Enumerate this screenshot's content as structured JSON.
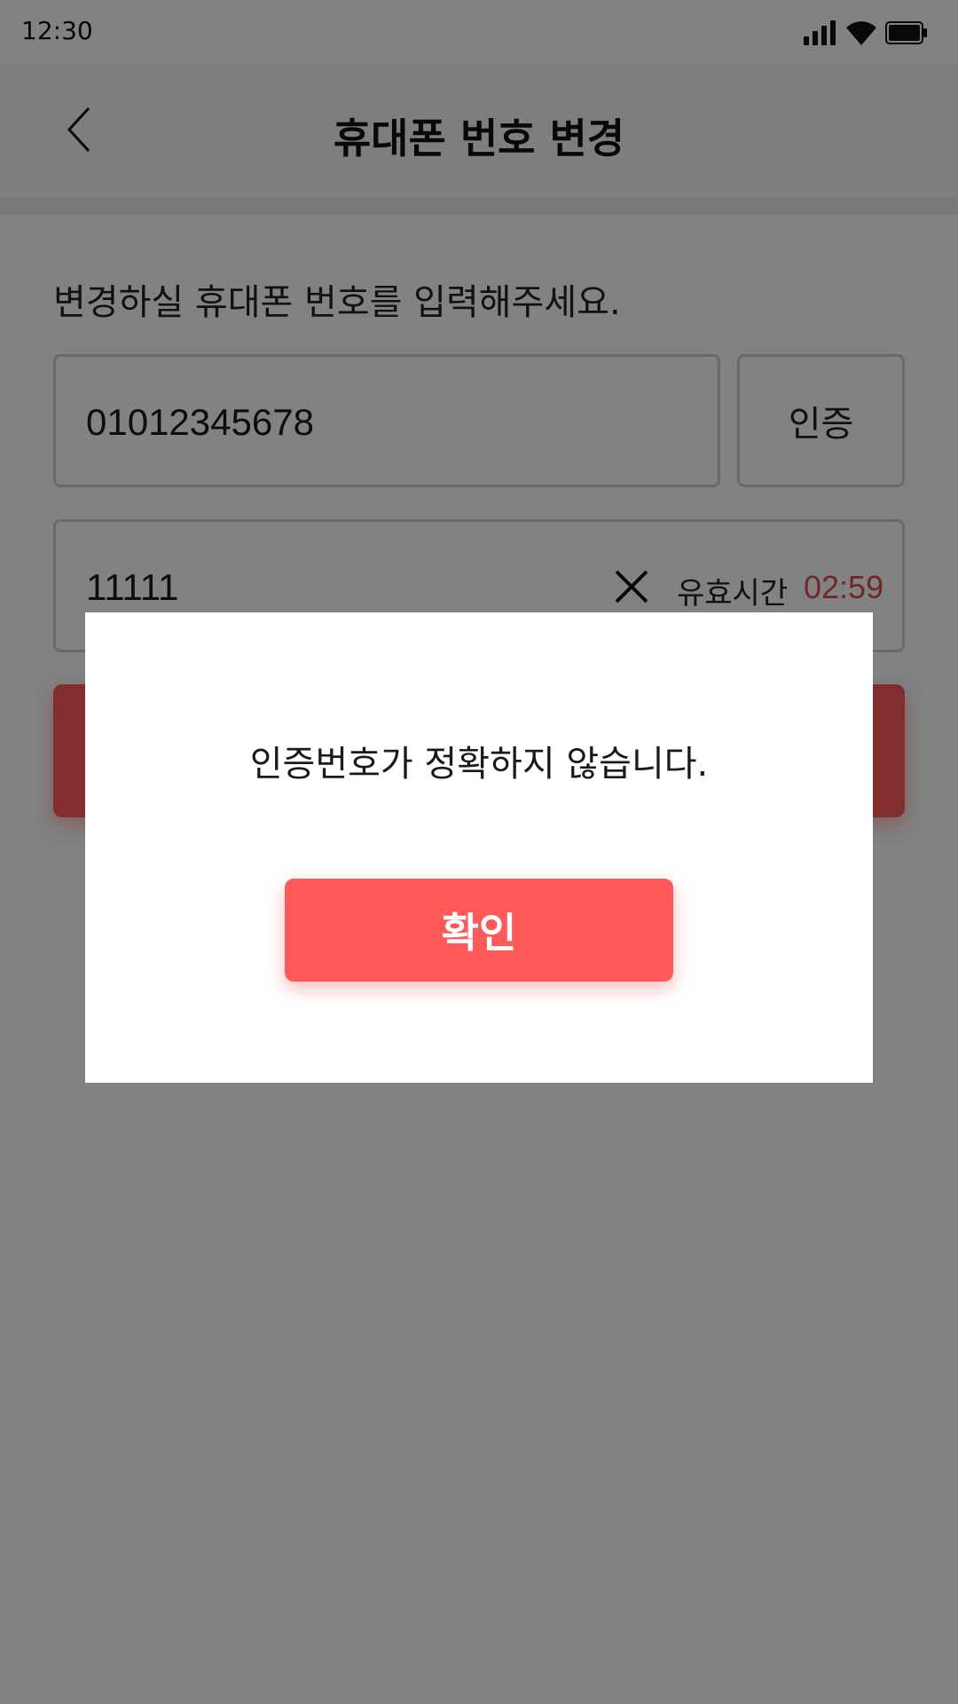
{
  "status_bar": {
    "time": "12:30",
    "icons": [
      "signal-icon",
      "wifi-icon",
      "battery-icon"
    ]
  },
  "header": {
    "title": "휴대폰 번호 변경",
    "back_icon": "chevron-left-icon"
  },
  "form": {
    "instruction": "변경하실 휴대폰 번호를 입력해주세요.",
    "phone_value": "01012345678",
    "verify_label": "인증",
    "code_value": "11111",
    "clear_icon": "close-icon",
    "timer_label": "유효시간",
    "timer_value": "02:59"
  },
  "dialog": {
    "message": "인증번호가 정확하지 않습니다.",
    "confirm_label": "확인"
  },
  "colors": {
    "accent": "#ff5a5a",
    "timer": "#e04b4b",
    "overlay": "rgba(0,0,0,0.49)"
  }
}
